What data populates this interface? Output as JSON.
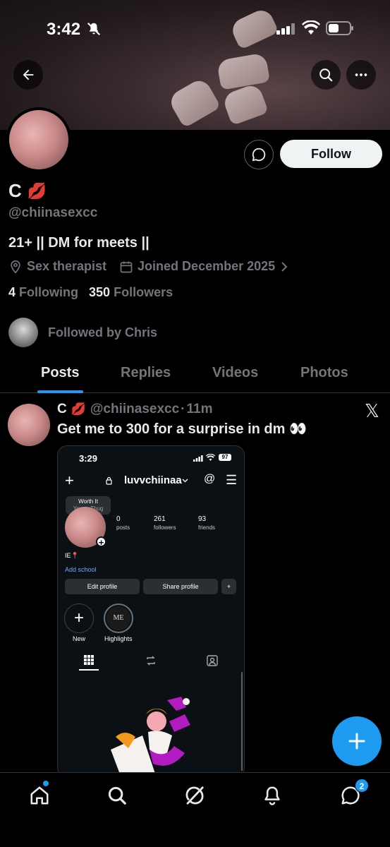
{
  "status_bar": {
    "time": "3:42"
  },
  "profile": {
    "display_name": "C",
    "name_emoji": "💋",
    "handle": "@chiinasexcc",
    "bio": "21+ || DM for meets ||",
    "location": "Sex therapist",
    "joined": "Joined December 2025",
    "following_count": "4",
    "following_label": "Following",
    "followers_count": "350",
    "followers_label": "Followers",
    "followed_by": "Followed by Chris",
    "follow_button": "Follow"
  },
  "tabs": [
    {
      "label": "Posts",
      "active": true
    },
    {
      "label": "Replies",
      "active": false
    },
    {
      "label": "Videos",
      "active": false
    },
    {
      "label": "Photos",
      "active": false
    }
  ],
  "post": {
    "author_name": "C",
    "author_emoji": "💋",
    "author_handle": "@chiinasexcc",
    "separator": "·",
    "time_ago": "11m",
    "text": "Get me to 300 for a surprise in dm 👀",
    "x_logo": "𝕏",
    "image": {
      "time": "3:29",
      "battery": "97",
      "username": "luvvchiinaa",
      "note_title": "Worth It",
      "note_sub": "Young Thug",
      "posts_count": "0",
      "posts_label": "posts",
      "followers_count": "261",
      "followers_label": "followers",
      "friends_count": "93",
      "friends_label": "friends",
      "bio": "IE📍",
      "add_school": "Add school",
      "edit_profile": "Edit profile",
      "share_profile": "Share profile",
      "new_label": "New",
      "highlights_label": "Highlights",
      "highlight_text": "ME"
    }
  },
  "bottom_nav": {
    "messages_badge": "2"
  },
  "colors": {
    "accent": "#1d9bf0",
    "text": "#e7e9ea",
    "muted": "#71767b",
    "border": "#2f3336"
  }
}
